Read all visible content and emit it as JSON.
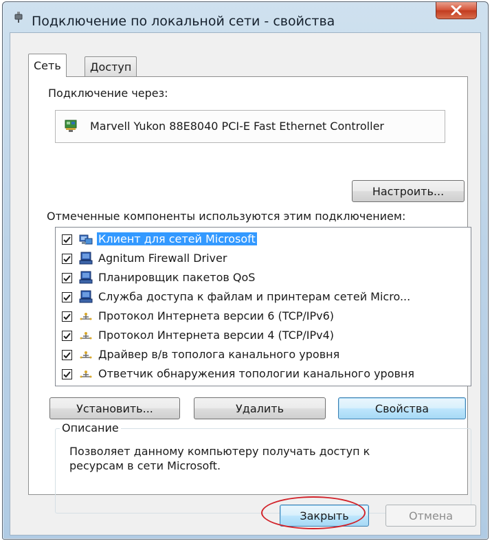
{
  "window": {
    "title": "Подключение по локальной сети - свойства",
    "close_icon": "close-x-icon"
  },
  "tabs": [
    {
      "label": "Сеть",
      "active": true
    },
    {
      "label": "Доступ",
      "active": false
    }
  ],
  "connection": {
    "via_label": "Подключение через:",
    "adapter_name": "Marvell Yukon 88E8040 PCI-E Fast Ethernet Controller",
    "configure_button": "Настроить..."
  },
  "components": {
    "heading": "Отмеченные компоненты используются этим подключением:",
    "items": [
      {
        "label": "Клиент для сетей Microsoft",
        "checked": true,
        "icon": "network-client-icon",
        "selected": true
      },
      {
        "label": "Agnitum Firewall Driver",
        "checked": true,
        "icon": "network-service-icon",
        "selected": false
      },
      {
        "label": "Планировщик пакетов QoS",
        "checked": true,
        "icon": "network-service-icon",
        "selected": false
      },
      {
        "label": "Служба доступа к файлам и принтерам сетей Micro...",
        "checked": true,
        "icon": "network-service-icon",
        "selected": false
      },
      {
        "label": "Протокол Интернета версии 6 (TCP/IPv6)",
        "checked": true,
        "icon": "protocol-icon",
        "selected": false
      },
      {
        "label": "Протокол Интернета версии 4 (TCP/IPv4)",
        "checked": true,
        "icon": "protocol-icon",
        "selected": false
      },
      {
        "label": "Драйвер в/в тополога канального уровня",
        "checked": true,
        "icon": "protocol-icon",
        "selected": false
      },
      {
        "label": "Ответчик обнаружения топологии канального уровня",
        "checked": true,
        "icon": "protocol-icon",
        "selected": false
      }
    ]
  },
  "actions": {
    "install": "Установить...",
    "remove": "Удалить",
    "properties": "Свойства"
  },
  "description": {
    "legend": "Описание",
    "text": "Позволяет данному компьютеру получать доступ к ресурсам в сети Microsoft."
  },
  "footer": {
    "close": "Закрыть",
    "cancel": "Отмена"
  },
  "colors": {
    "selection": "#3399ff",
    "annotation": "#d2232a"
  }
}
